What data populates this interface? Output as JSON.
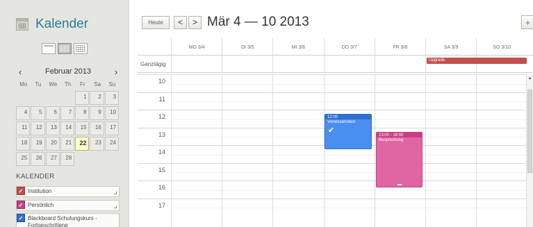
{
  "sidebar": {
    "title": "Kalender",
    "mini_month": "Februar 2013",
    "prev_arrow": "‹",
    "next_arrow": "›",
    "weekdays": [
      "Mo",
      "Tu",
      "We",
      "Th",
      "Fr",
      "Sa",
      "Su"
    ],
    "days": [
      [
        "",
        "",
        "",
        "",
        "1",
        "2",
        "3"
      ],
      [
        "4",
        "5",
        "6",
        "7",
        "8",
        "9",
        "10"
      ],
      [
        "11",
        "12",
        "13",
        "14",
        "15",
        "16",
        "17"
      ],
      [
        "18",
        "19",
        "20",
        "21",
        "22",
        "23",
        "24"
      ],
      [
        "25",
        "26",
        "27",
        "28",
        "",
        "",
        ""
      ]
    ],
    "today": "22",
    "section_label": "KALENDER",
    "calendars": [
      {
        "label": "Institution",
        "color": "#c1504e"
      },
      {
        "label": "Persönlich",
        "color": "#c63f86"
      },
      {
        "label": "Blackboard Schulungskurs - Fortgeschrittene",
        "color": "#2f6fd0"
      }
    ]
  },
  "toolbar": {
    "today_label": "Heute",
    "prev": "<",
    "next": ">",
    "range_title": "Mär 4 — 10 2013",
    "add": "+"
  },
  "week": {
    "columns": [
      "MO 3/4",
      "DI 3/5",
      "MI 3/6",
      "DO 3/7",
      "FR 3/8",
      "SA 3/9",
      "SO 3/10"
    ],
    "allday_label": "Ganztägig",
    "hours": [
      "10",
      "11",
      "12",
      "13",
      "14",
      "15",
      "16",
      "17"
    ]
  },
  "events": {
    "allday": {
      "title": "Upgrade",
      "color": "#c1504e"
    },
    "vorwissenstest": {
      "time": "12:00",
      "title": "Vorwissenstest",
      "color": "#4a8ff0"
    },
    "besprechung": {
      "time": "13:00 - 16:00",
      "title": "Besprechung",
      "color": "#e065a3"
    }
  }
}
